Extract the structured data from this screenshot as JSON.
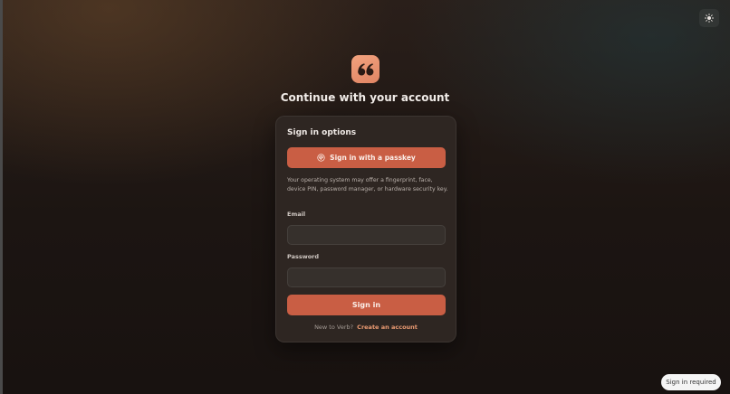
{
  "header": {
    "title": "Continue with your account",
    "logo_icon": "quote-icon",
    "theme_toggle_icon": "sun-icon"
  },
  "card": {
    "title": "Sign in options",
    "passkey_button": {
      "label": "Sign in with a passkey",
      "icon": "fingerprint-icon"
    },
    "help_text": "Your operating system may offer a fingerprint, face, device PIN, password manager, or hardware security key.",
    "email": {
      "label": "Email",
      "value": "",
      "placeholder": ""
    },
    "password": {
      "label": "Password",
      "value": "",
      "placeholder": ""
    },
    "signin_button": {
      "label": "Sign in"
    },
    "signup": {
      "prompt": "New to Verb?",
      "link": "Create an account"
    }
  },
  "toast": {
    "text": "Sign in required"
  },
  "colors": {
    "accent": "#c95e44",
    "logo": "#ec9574",
    "link": "#ea9a72",
    "card_bg": "#2e2622"
  }
}
